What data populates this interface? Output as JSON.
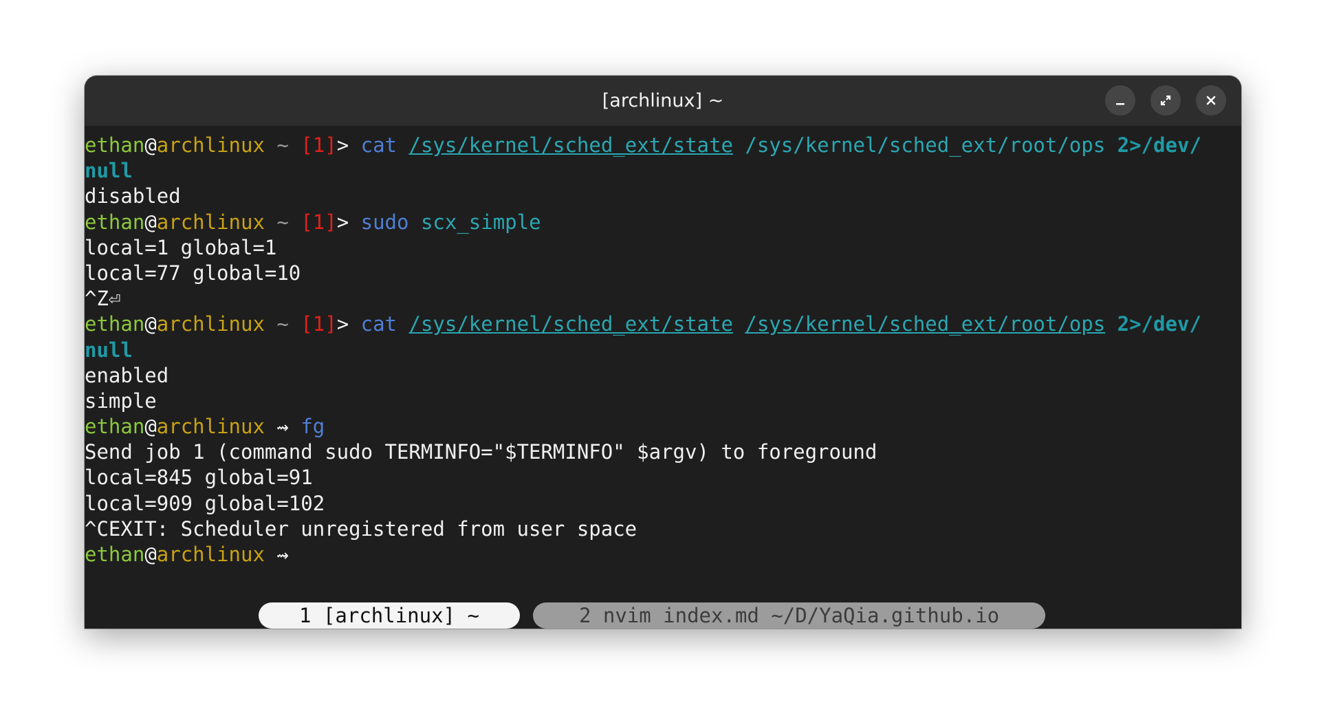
{
  "window": {
    "title": "[archlinux] ~",
    "buttons": [
      "minimize",
      "maximize",
      "close"
    ]
  },
  "prompt": {
    "user": "ethan",
    "at": "@",
    "host": "archlinux",
    "cwd": "~",
    "status": "[1]",
    "arrow": "⇝"
  },
  "terminal": {
    "line1": {
      "cmd": "cat",
      "arg1": "/sys/kernel/sched_ext/state",
      "arg2": "/sys/kernel/sched_ext/root/ops",
      "redirect": "2>/dev/",
      "wrap": "null"
    },
    "out1": "disabled",
    "line2": {
      "cmd": "sudo",
      "arg1": "scx_simple"
    },
    "out2": [
      "local=1 global=1",
      "local=77 global=10",
      "^Z⏎"
    ],
    "line3": {
      "cmd": "cat",
      "arg1": "/sys/kernel/sched_ext/state",
      "arg2": "/sys/kernel/sched_ext/root/ops",
      "redirect": "2>/dev/",
      "wrap": "null"
    },
    "out3": [
      "enabled",
      "simple"
    ],
    "line4": {
      "cmd": "fg"
    },
    "out4": [
      "Send job 1 (command sudo TERMINFO=\"$TERMINFO\" $argv) to foreground",
      "local=845 global=91",
      "local=909 global=102",
      "^CEXIT: Scheduler unregistered from user space"
    ]
  },
  "tabs": [
    {
      "label": "1 [archlinux] ~",
      "active": true
    },
    {
      "label": "2 nvim index.md ~/D/YaQia.github.io",
      "active": false
    }
  ],
  "colors": {
    "user": "#8cc83c",
    "host": "#c8a214",
    "status": "#e0201a",
    "command": "#4f7fd6",
    "path": "#2aa7b2",
    "background": "#1e1e1e"
  }
}
